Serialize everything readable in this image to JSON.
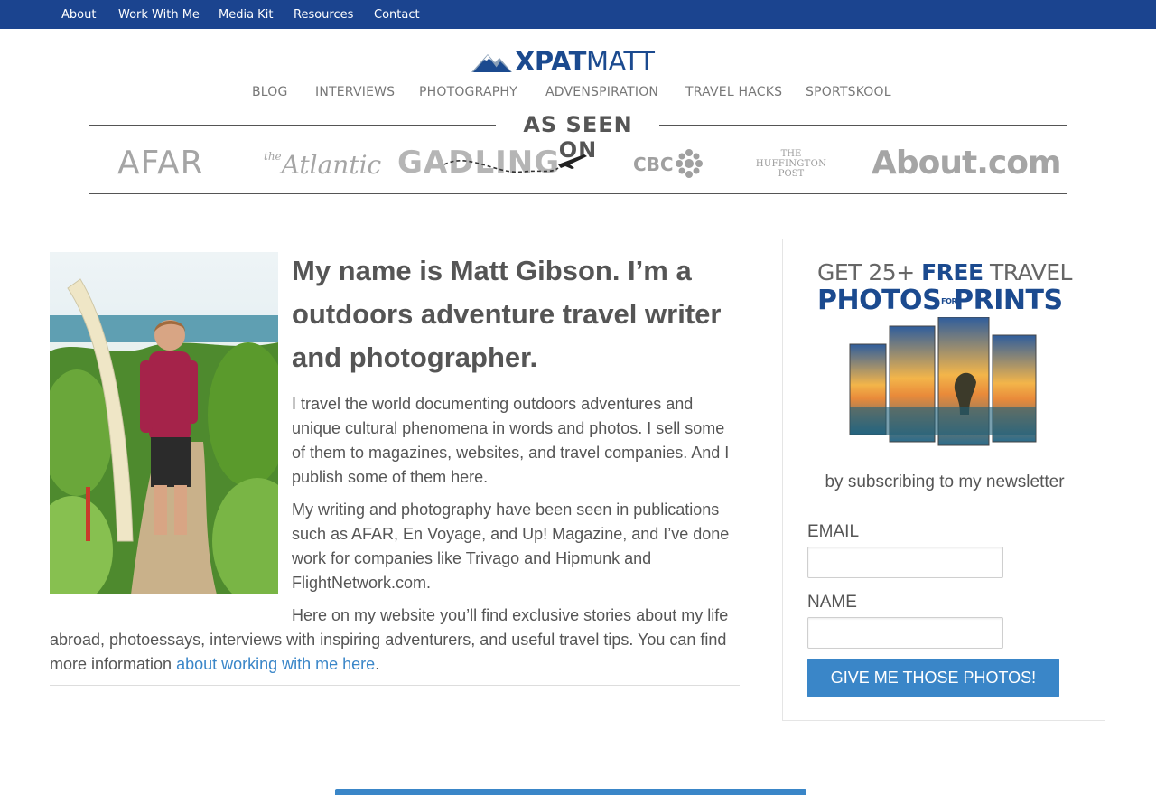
{
  "topnav": {
    "items": [
      "About",
      "Work With Me",
      "Media Kit",
      "Resources",
      "Contact"
    ]
  },
  "logo": {
    "part1": "XPAT",
    "part2": "MATT"
  },
  "mainnav": {
    "items": [
      "BLOG",
      "INTERVIEWS",
      "PHOTOGRAPHY",
      "ADVENSPIRATION",
      "TRAVEL HACKS",
      "SPORTSKOOL"
    ]
  },
  "seen_on": {
    "title": "AS SEEN ON",
    "logos": {
      "afar": "AFAR",
      "atlantic_the": "the",
      "atlantic": "Atlantic",
      "gadling": "GADLING",
      "cbc": "CBC",
      "huffington_1": "THE",
      "huffington_2": "HUFFINGTON",
      "huffington_3": "POST",
      "about_1": "About",
      "about_2": ".com"
    }
  },
  "main": {
    "headline": "My name is Matt Gibson. I’m a outdoors adventure travel writer and photographer.",
    "para1": "I travel the world documenting outdoors adventures and unique cultural phenomena in words and  photos. I sell some of them to magazines, websites, and travel companies. And I publish some of them here.",
    "para2": "My writing and photography have been seen in publications such as AFAR, En Voyage, and Up! Magazine, and I’ve done work for companies like Trivago and Hipmunk and FlightNetwork.com.",
    "para3_text": "Here on my website  you’ll find exclusive stories about my life abroad, photoessays, interviews with inspiring adventurers, and useful travel tips.  You can find more information ",
    "para3_link": "about working with me here",
    "para3_end": "."
  },
  "sidebar": {
    "promo_line1_a": "GET 25+ ",
    "promo_line1_free": "FREE",
    "promo_line1_b": " TRAVEL",
    "promo_line2_a": "PHOTOS",
    "promo_line2_for": "FOR",
    "promo_line2_b": "PRINTS",
    "subscribe_text": "by subscribing to my newsletter",
    "email_label": "EMAIL",
    "email_value": "",
    "name_label": "NAME",
    "name_value": "",
    "button_label": "GIVE ME THOSE PHOTOS!"
  },
  "colors": {
    "topbar": "#1b448f",
    "brand": "#1b4a8f",
    "link": "#3a86c8",
    "button": "#3a86c8"
  }
}
